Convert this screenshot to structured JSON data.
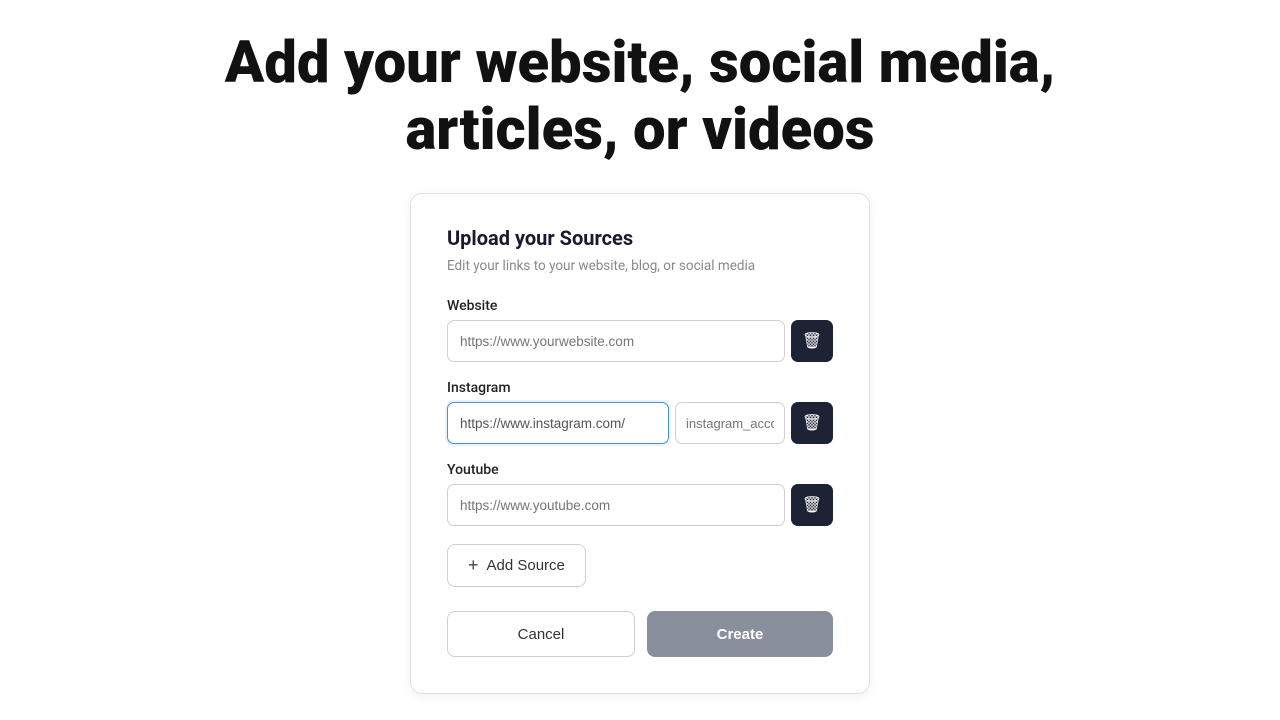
{
  "page": {
    "title_line1": "Add your website, social media,",
    "title_line2": "articles, or videos"
  },
  "card": {
    "title": "Upload your Sources",
    "subtitle": "Edit your links to your website, blog, or social media",
    "fields": [
      {
        "id": "website",
        "label": "Website",
        "placeholder": "https://www.yourwebsite.com",
        "value": "",
        "secondary_placeholder": null,
        "active": false
      },
      {
        "id": "instagram",
        "label": "Instagram",
        "placeholder": "https://www.instagram.com/",
        "value": "https://www.instagram.com/",
        "secondary_placeholder": "instagram_acco",
        "active": true
      },
      {
        "id": "youtube",
        "label": "Youtube",
        "placeholder": "https://www.youtube.com",
        "value": "",
        "secondary_placeholder": null,
        "active": false
      }
    ],
    "add_source_label": "Add Source",
    "cancel_label": "Cancel",
    "create_label": "Create"
  }
}
